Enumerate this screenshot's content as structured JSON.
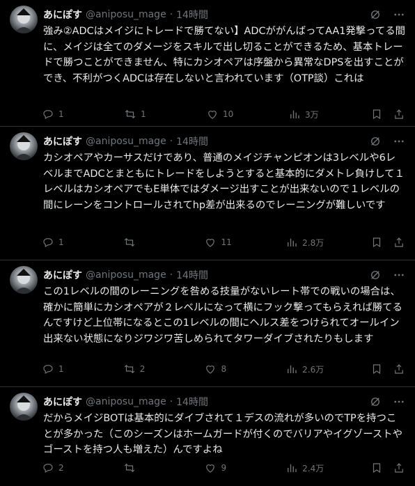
{
  "tweets": [
    {
      "name": "あにぽす",
      "handle": "@aniposu_mage",
      "dot": "·",
      "time": "14時間",
      "text": "強み②ADCはメイジにトレードで勝てない】ADCががんばってAA1発撃ってる間に、メイジは全てのダメージをスキルで出し切ることができるため、基本トレードで勝つことができません、特にカシオペアは序盤から異常なDPSを出すことができ、不利がつくADCは存在しないと言われています（OTP談）これは",
      "replies": "1",
      "reposts": "1",
      "likes": "10",
      "views": "3万"
    },
    {
      "name": "あにぽす",
      "handle": "@aniposu_mage",
      "dot": "·",
      "time": "14時間",
      "text": "カシオペアやカーサスだけであり、普通のメイジチャンピオンは3レベルや6レベルまでADCとまともにトレードをしようとすると基本的にダメトレ負けして１レベルはカシオペアでもE単体ではダメージ出すことが出来ないので１レベルの間にレーンをコントロールされてhp差が出来るのでレーニングが難しいです",
      "replies": "1",
      "reposts": "",
      "likes": "11",
      "views": "2.8万"
    },
    {
      "name": "あにぽす",
      "handle": "@aniposu_mage",
      "dot": "·",
      "time": "14時間",
      "text": "この1レベルの間のレーニングを咎める技量がないレート帯での戦いの場合は、確かに簡単にカシオペアが２レベルになって横にフック撃ってもらえれば勝てるんですけど上位帯になるとこの1レベルの間にヘルス差をつけられてオールイン出来ない状態になりジワジワ苦しめられてタワーダイブされたりもします",
      "replies": "1",
      "reposts": "2",
      "likes": "8",
      "views": "2.6万"
    },
    {
      "name": "あにぽす",
      "handle": "@aniposu_mage",
      "dot": "·",
      "time": "14時間",
      "text": "だからメイジBOTは基本的にダイブされて１デスの流れが多いのでTPを持つことが多かった（このシーズンはホームガードが付くのでバリアやイグゾーストやゴーストを持つ人も増えた）んですよね",
      "replies": "2",
      "reposts": "",
      "likes": "9",
      "views": "2.4万"
    }
  ]
}
